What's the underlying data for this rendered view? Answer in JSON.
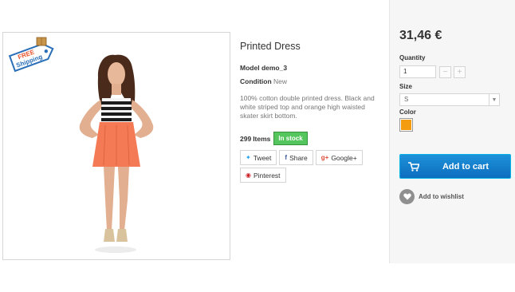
{
  "product": {
    "title": "Printed Dress",
    "model_label": "Model",
    "model_value": "demo_3",
    "condition_label": "Condition",
    "condition_value": "New",
    "description": "100% cotton double printed dress. Black and white striped top and orange high waisted skater skirt bottom.",
    "quantity_count": "299",
    "quantity_unit": "Items",
    "stock_status": "In stock",
    "badge": {
      "line1": "FREE",
      "line2": "Shipping"
    }
  },
  "share": {
    "tweet": "Tweet",
    "share": "Share",
    "google": "Google+",
    "pinterest": "Pinterest"
  },
  "buy": {
    "price": "31,46 €",
    "quantity_label": "Quantity",
    "quantity_value": "1",
    "minus": "−",
    "plus": "+",
    "size_label": "Size",
    "size_value": "S",
    "color_label": "Color",
    "color_swatch": "#f39c11",
    "add_to_cart": "Add to cart",
    "wishlist": "Add to wishlist"
  },
  "icons": {
    "twitter": "twitter-icon",
    "facebook": "facebook-icon",
    "google": "google-plus-icon",
    "pinterest": "pinterest-icon",
    "cart": "cart-icon",
    "heart": "heart-icon"
  }
}
